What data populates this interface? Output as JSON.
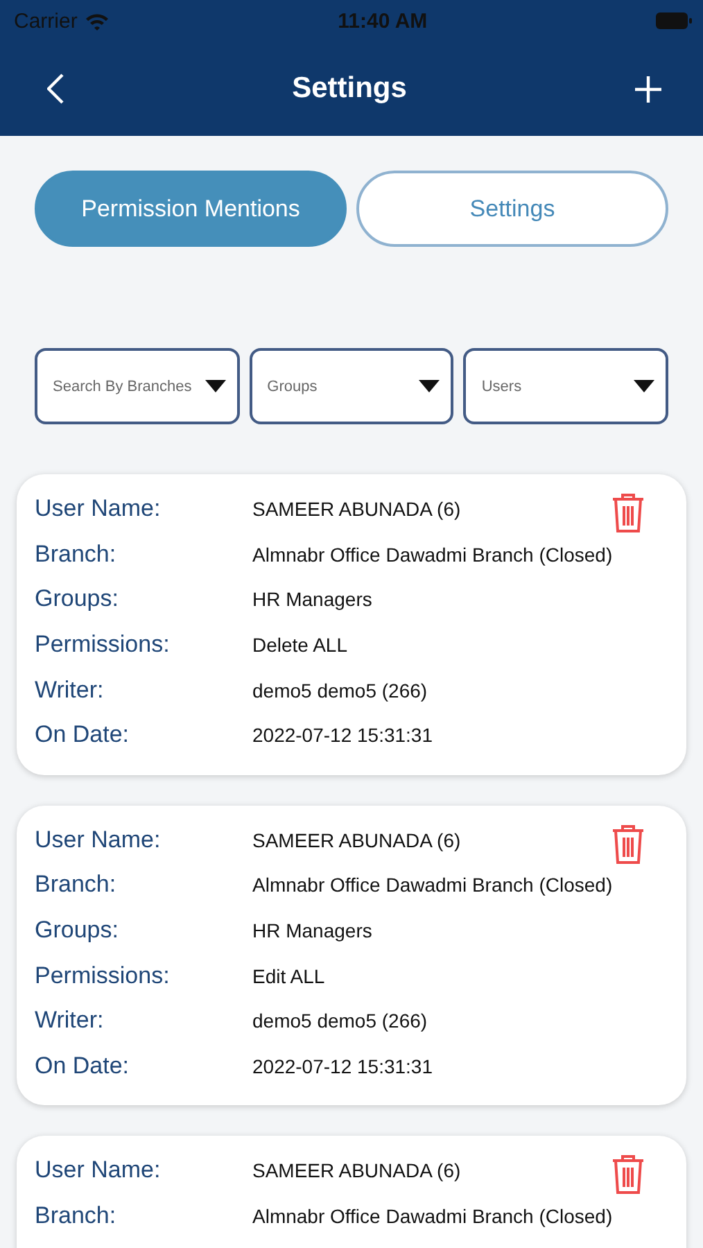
{
  "status_bar": {
    "carrier": "Carrier",
    "time": "11:40 AM"
  },
  "nav_bar": {
    "title": "Settings"
  },
  "tabs": [
    {
      "label": "Permission Mentions",
      "selected": true
    },
    {
      "label": "Settings",
      "selected": false
    }
  ],
  "filters": [
    {
      "placeholder": "Search By Branches"
    },
    {
      "placeholder": "Groups"
    },
    {
      "placeholder": "Users"
    }
  ],
  "cards": [
    {
      "rows": [
        {
          "label": "User Name:",
          "value": "SAMEER ABUNADA (6)"
        },
        {
          "label": "Branch:",
          "value": "Almnabr Office Dawadmi Branch (Closed)"
        },
        {
          "label": "Groups:",
          "value": "HR Managers"
        },
        {
          "label": "Permissions:",
          "value": "Delete ALL"
        },
        {
          "label": "Writer:",
          "value": "demo5 demo5 (266)"
        },
        {
          "label": "On Date:",
          "value": "2022-07-12 15:31:31"
        }
      ]
    },
    {
      "rows": [
        {
          "label": "User Name:",
          "value": "SAMEER ABUNADA (6)"
        },
        {
          "label": "Branch:",
          "value": "Almnabr Office Dawadmi Branch (Closed)"
        },
        {
          "label": "Groups:",
          "value": "HR Managers"
        },
        {
          "label": "Permissions:",
          "value": "Edit ALL"
        },
        {
          "label": "Writer:",
          "value": "demo5 demo5 (266)"
        },
        {
          "label": "On Date:",
          "value": "2022-07-12 15:31:31"
        }
      ]
    },
    {
      "rows": [
        {
          "label": "User Name:",
          "value": "SAMEER ABUNADA (6)"
        },
        {
          "label": "Branch:",
          "value": "Almnabr Office Dawadmi Branch (Closed)"
        }
      ]
    }
  ]
}
